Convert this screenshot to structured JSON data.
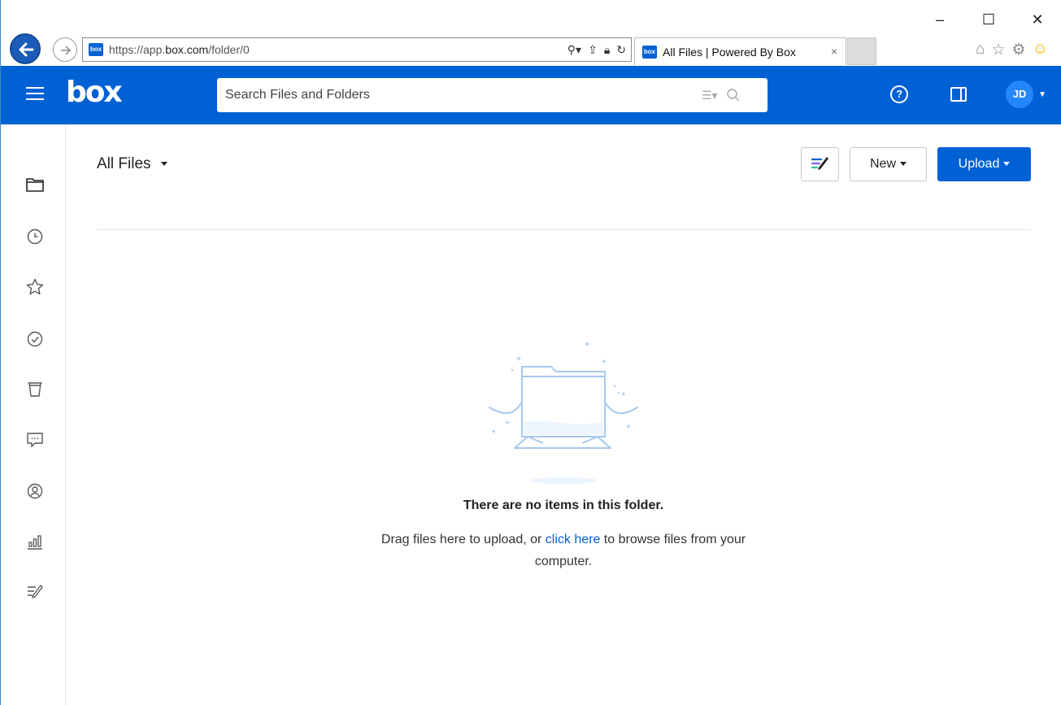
{
  "browser": {
    "url_prefix": "https://app.",
    "url_domain": "box.com",
    "url_path": "/folder/0",
    "favicon_text": "box",
    "tab_title": "All Files | Powered By Box",
    "tab_close": "×",
    "window_controls": {
      "minimize": "–",
      "maximize": "☐",
      "close": "✕"
    }
  },
  "header": {
    "logo": "box",
    "search_placeholder": "Search Files and Folders",
    "avatar_initials": "JD"
  },
  "sidebar": {
    "items": [
      {
        "name": "all-files",
        "icon": "folder-icon"
      },
      {
        "name": "recents",
        "icon": "clock-icon"
      },
      {
        "name": "favorites",
        "icon": "star-icon"
      },
      {
        "name": "tasks",
        "icon": "check-circle-icon"
      },
      {
        "name": "trash",
        "icon": "trash-icon"
      },
      {
        "name": "notifications",
        "icon": "comment-icon"
      },
      {
        "name": "admin",
        "icon": "user-circle-icon"
      },
      {
        "name": "insights",
        "icon": "bar-chart-icon"
      },
      {
        "name": "notes",
        "icon": "notes-icon"
      }
    ]
  },
  "main": {
    "title": "All Files",
    "new_label": "New",
    "upload_label": "Upload",
    "empty_title": "There are no items in this folder.",
    "empty_text_before": "Drag files here to upload, or ",
    "empty_link": "click here",
    "empty_text_after": " to browse files from your computer."
  },
  "colors": {
    "brand_blue": "#0061d5",
    "avatar_blue": "#2486fc",
    "illustration_blue": "#a6c8ee"
  }
}
